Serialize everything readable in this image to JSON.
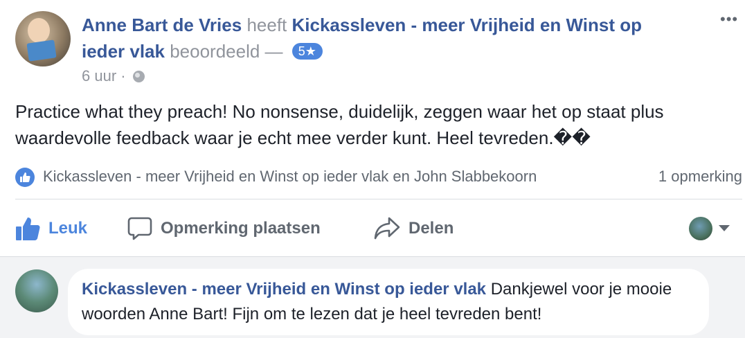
{
  "post": {
    "author": "Anne Bart de Vries",
    "verb": "heeft",
    "page_name_part1": "Kickassleven - meer Vrijheid en Winst op",
    "page_name_part2": "ieder vlak",
    "action_word": "beoordeeld —",
    "rating": "5★",
    "time": "6 uur",
    "separator": "·",
    "more_icon": "•••",
    "text": "Practice what they preach! No nonsense, duidelijk, zeggen waar het op staat plus waardevolle feedback waar je echt mee verder kunt. Heel tevreden.��"
  },
  "reactions": {
    "names": "Kickassleven - meer Vrijheid en Winst op ieder vlak en John Slabbekoorn",
    "comment_count": "1 opmerking"
  },
  "actions": {
    "like": "Leuk",
    "comment": "Opmerking plaatsen",
    "share": "Delen"
  },
  "comment": {
    "author": "Kickassleven - meer Vrijheid en Winst op ieder vlak",
    "text": "Dankjewel voor je mooie woorden Anne Bart! Fijn om te lezen dat je heel tevreden bent!"
  },
  "colors": {
    "link": "#385898",
    "accent": "#4c85dd",
    "muted": "#90949c"
  },
  "icons": [
    "globe-icon",
    "more-icon",
    "like-icon",
    "comment-icon",
    "share-icon",
    "caret-down-icon"
  ]
}
